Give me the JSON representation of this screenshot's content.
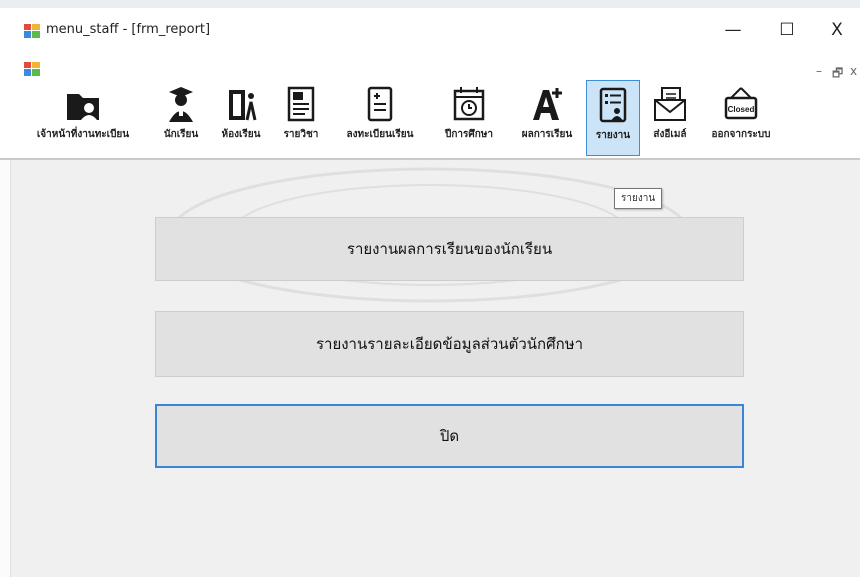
{
  "window": {
    "title": "menu_staff - [frm_report]",
    "minimize": "—",
    "maximize": "☐",
    "close": "X"
  },
  "mdi_controls": {
    "minimize": "–",
    "restore": "🗗",
    "close": "x"
  },
  "toolbar": {
    "items": [
      {
        "label": "เจ้าหน้าที่งานทะเบียน",
        "icon": "staff-folder-icon"
      },
      {
        "label": "นักเรียน",
        "icon": "graduate-icon"
      },
      {
        "label": "ห้องเรียน",
        "icon": "classroom-door-icon"
      },
      {
        "label": "รายวิชา",
        "icon": "subject-book-icon"
      },
      {
        "label": "ลงทะเบียนเรียน",
        "icon": "register-list-icon"
      },
      {
        "label": "ปีการศึกษา",
        "icon": "calendar-clock-icon"
      },
      {
        "label": "ผลการเรียน",
        "icon": "grade-a-plus-icon"
      },
      {
        "label": "รายงาน",
        "icon": "report-icon",
        "active": true
      },
      {
        "label": "ส่งอีเมล์",
        "icon": "email-icon"
      },
      {
        "label": "ออกจากระบบ",
        "icon": "closed-sign-icon",
        "sign_text": "Closed"
      }
    ]
  },
  "tooltip": "รายงาน",
  "buttons": {
    "student_results_report": "รายงานผลการเรียนของนักเรียน",
    "student_details_report": "รายงานรายละเอียดข้อมูลส่วนตัวนักศึกษา",
    "close": "ปิด"
  },
  "colors": {
    "active_toolbar_bg": "#cce4f7",
    "active_toolbar_border": "#3c8ed6",
    "focus_border": "#3a86d4",
    "button_bg": "#e1e1e1"
  }
}
